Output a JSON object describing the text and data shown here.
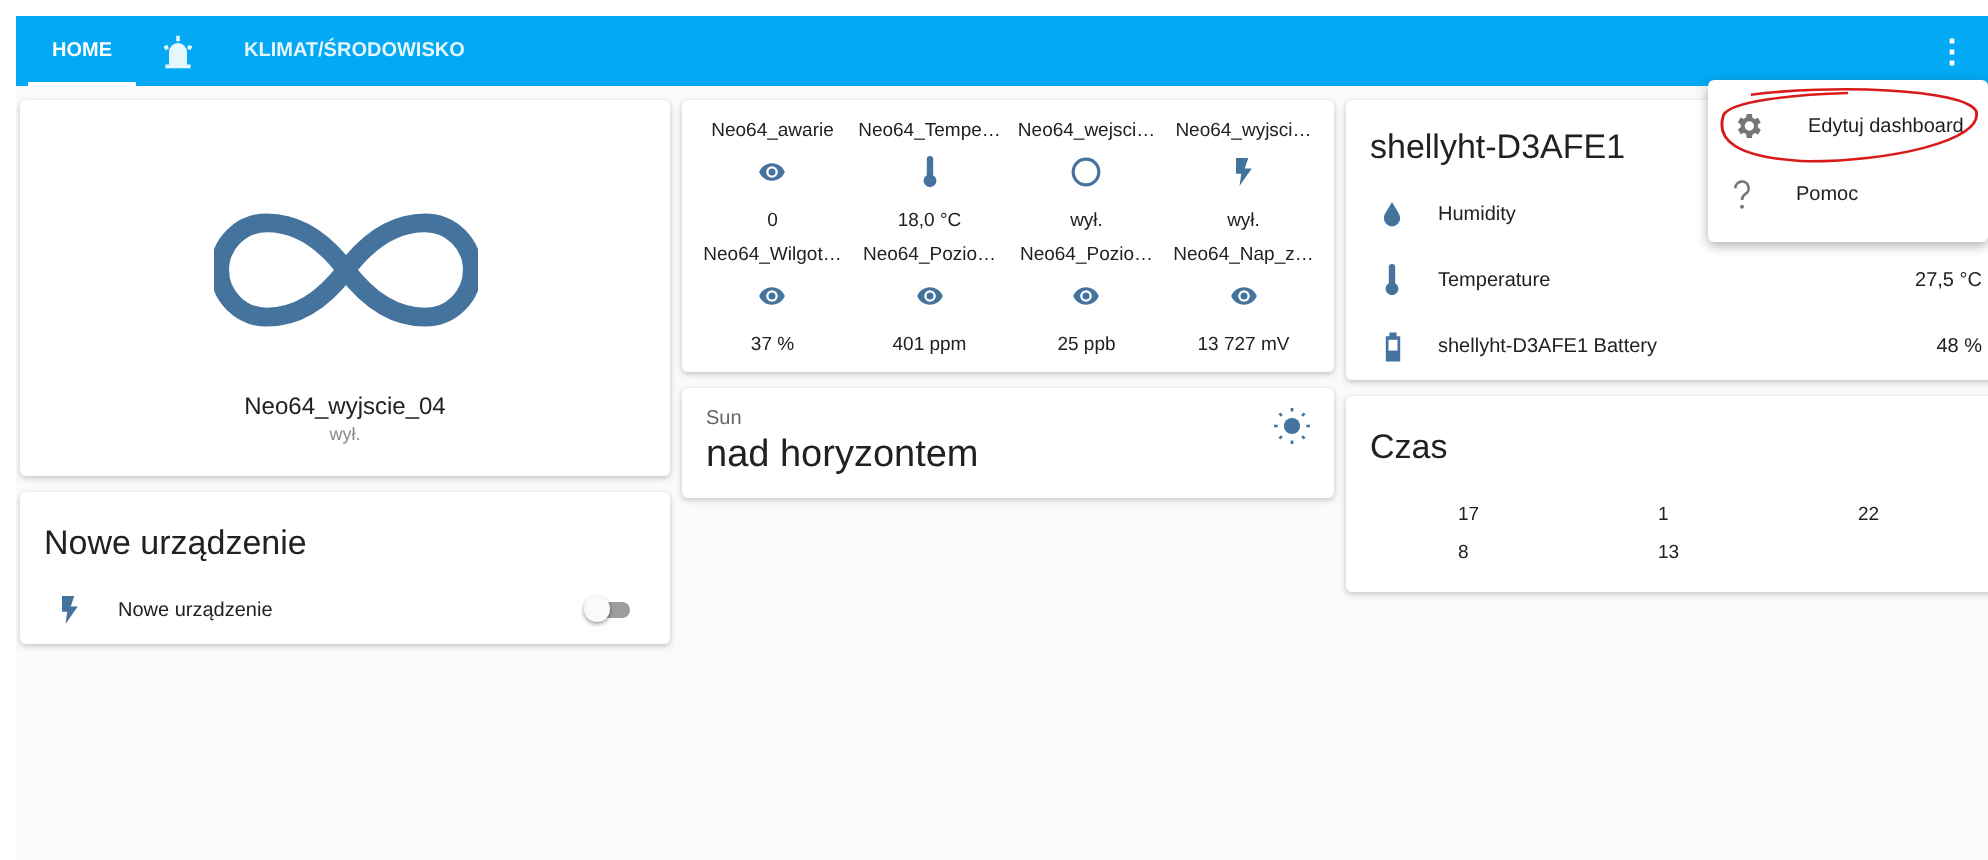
{
  "tabs": [
    {
      "kind": "text",
      "label": "HOME",
      "selected": true
    },
    {
      "kind": "icon",
      "selected": false
    },
    {
      "kind": "text",
      "label": "KLIMAT/ŚRODOWISKO",
      "selected": false
    }
  ],
  "menu_button": "⋮",
  "overflow_menu": [
    {
      "kind": "gear",
      "label": "Edytuj dashboard",
      "highlighted": true
    },
    {
      "kind": "help",
      "label": "Pomoc",
      "highlighted": false
    }
  ],
  "picture_card": {
    "name": "Neo64_wyjscie_04",
    "state": "wył."
  },
  "switch_card": {
    "title": "Nowe urządzenie",
    "rows": [
      {
        "name": "Nowe urządzenie",
        "on": false
      }
    ]
  },
  "glance_card": {
    "entities": [
      {
        "name": "Neo64_awarie",
        "kind": "eye",
        "state": "0"
      },
      {
        "name": "Neo64_Tempe…",
        "kind": "thermometer",
        "state": "18,0 °C"
      },
      {
        "name": "Neo64_wejsci…",
        "kind": "circle",
        "state": "wył."
      },
      {
        "name": "Neo64_wyjsci…",
        "kind": "flash",
        "state": "wył."
      },
      {
        "name": "Neo64_Wilgot…",
        "kind": "eye",
        "state": "37 %"
      },
      {
        "name": "Neo64_Pozio…",
        "kind": "eye",
        "state": "401 ppm"
      },
      {
        "name": "Neo64_Pozio…",
        "kind": "eye",
        "state": "25 ppb"
      },
      {
        "name": "Neo64_Nap_z…",
        "kind": "eye",
        "state": "13 727 mV"
      }
    ]
  },
  "sun_card": {
    "name": "Sun",
    "state": "nad horyzontem"
  },
  "entities_card": {
    "title": "shellyht-D3AFE1",
    "rows": [
      {
        "kind": "water",
        "name": "Humidity"
      },
      {
        "kind": "thermometer",
        "name": "Temperature",
        "value": "27,5 °C"
      },
      {
        "kind": "battery",
        "name": "shellyht-D3AFE1 Battery",
        "value": "48 %"
      }
    ]
  },
  "time_card": {
    "title": "Czas",
    "values": [
      "17",
      "1",
      "22",
      "8",
      "13"
    ]
  }
}
